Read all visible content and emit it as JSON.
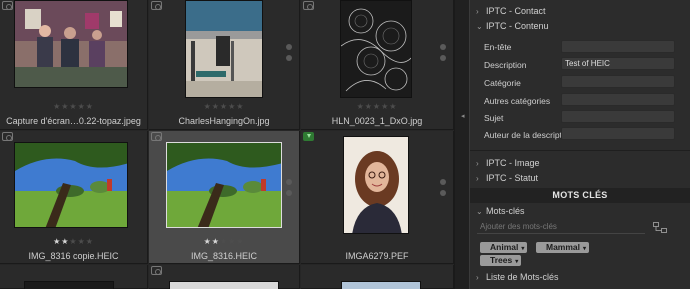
{
  "grid": {
    "cells": [
      {
        "name": "Capture d'écran…0.22-topaz.jpeg",
        "stars": 0,
        "badge": "camera"
      },
      {
        "name": "CharlesHangingOn.jpg",
        "stars": 0,
        "badge": "camera"
      },
      {
        "name": "HLN_0023_1_DxO.jpg",
        "stars": 0,
        "badge": "camera"
      },
      {
        "name": "IMG_8316 copie.HEIC",
        "stars": 2,
        "badge": "camera"
      },
      {
        "name": "IMG_8316.HEIC",
        "stars": 2,
        "badge": "camera"
      },
      {
        "name": "IMGA6279.PEF",
        "stars": 0,
        "badge": "download"
      }
    ]
  },
  "panel": {
    "sections": {
      "contact": "IPTC - Contact",
      "contenu": "IPTC - Contenu",
      "image": "IPTC - Image",
      "statut": "IPTC - Statut"
    },
    "fields": [
      {
        "label": "En-tête",
        "value": ""
      },
      {
        "label": "Description",
        "value": "Test of HEIC"
      },
      {
        "label": "Catégorie",
        "value": ""
      },
      {
        "label": "Autres catégories",
        "value": ""
      },
      {
        "label": "Sujet",
        "value": ""
      },
      {
        "label": "Auteur de la descript",
        "value": ""
      }
    ],
    "keywords": {
      "header": "MOTS CLÉS",
      "section": "Mots-clés",
      "placeholder": "Ajouter des mots-clés",
      "tags": [
        "Animal",
        "Mammal",
        "Trees"
      ],
      "list_section": "Liste de Mots-clés"
    }
  },
  "colors": {
    "accent_download": "#2f7a33",
    "selected_cell": "#4a4a4a"
  }
}
